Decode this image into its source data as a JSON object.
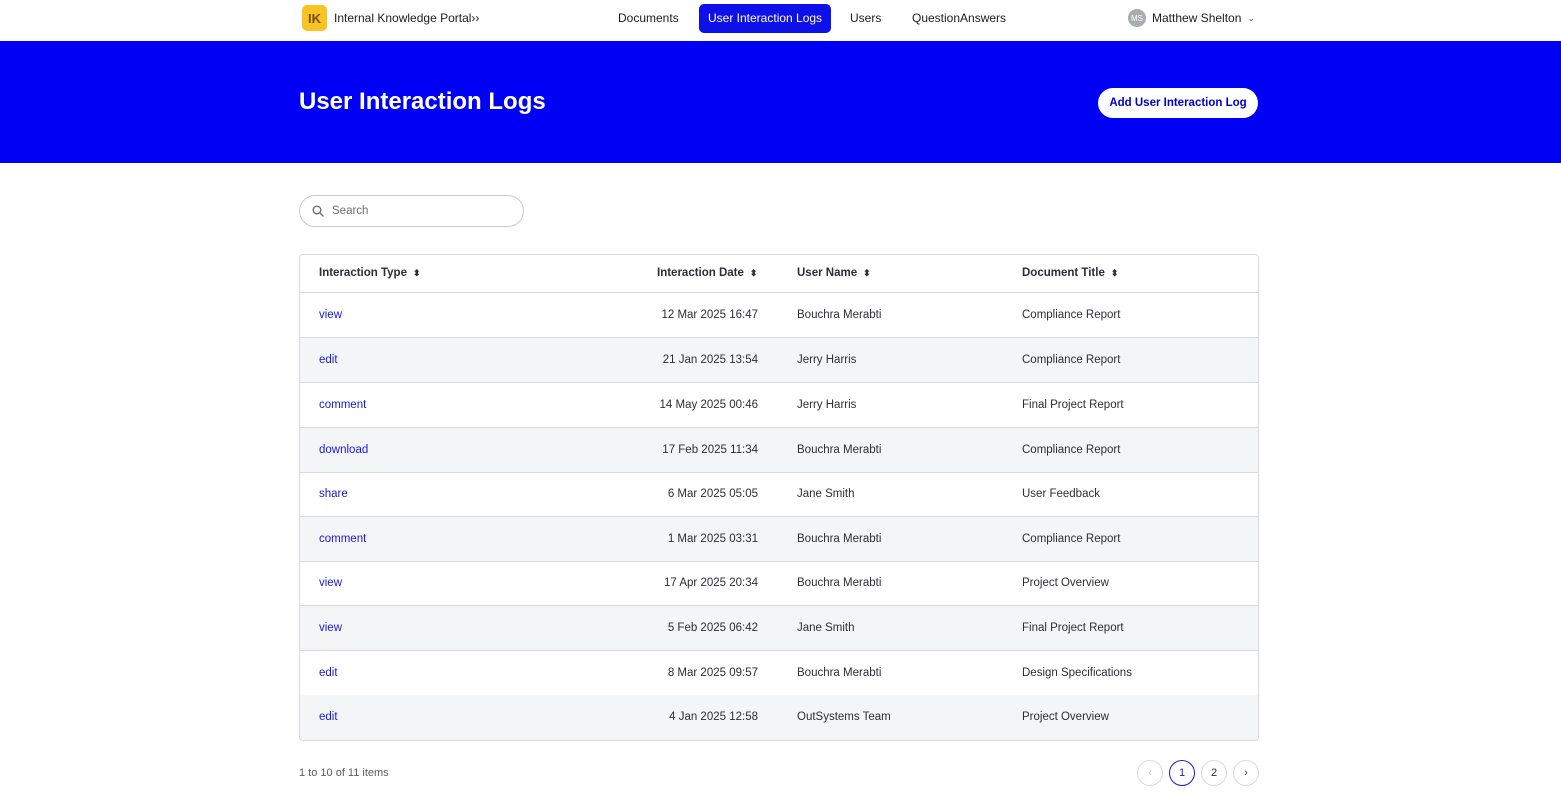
{
  "app": {
    "logo_text": "IK",
    "name": "Internal Knowledge Portal››"
  },
  "nav": [
    {
      "label": "Documents",
      "active": false
    },
    {
      "label": "User Interaction Logs",
      "active": true
    },
    {
      "label": "Users",
      "active": false
    },
    {
      "label": "QuestionAnswers",
      "active": false
    }
  ],
  "user": {
    "initials": "MS",
    "name": "Matthew Shelton"
  },
  "banner": {
    "title": "User Interaction Logs",
    "add_button": "Add User Interaction Log"
  },
  "search": {
    "placeholder": "Search",
    "value": ""
  },
  "table": {
    "columns": [
      "Interaction Type",
      "Interaction Date",
      "User Name",
      "Document Title"
    ],
    "rows": [
      {
        "type": "view",
        "date": "12 Mar 2025 16:47",
        "user": "Bouchra Merabti",
        "document": "Compliance Report"
      },
      {
        "type": "edit",
        "date": "21 Jan 2025 13:54",
        "user": "Jerry Harris",
        "document": "Compliance Report"
      },
      {
        "type": "comment",
        "date": "14 May 2025 00:46",
        "user": "Jerry Harris",
        "document": "Final Project Report"
      },
      {
        "type": "download",
        "date": "17 Feb 2025 11:34",
        "user": "Bouchra Merabti",
        "document": "Compliance Report"
      },
      {
        "type": "share",
        "date": "6 Mar 2025 05:05",
        "user": "Jane Smith",
        "document": "User Feedback"
      },
      {
        "type": "comment",
        "date": "1 Mar 2025 03:31",
        "user": "Bouchra Merabti",
        "document": "Compliance Report"
      },
      {
        "type": "view",
        "date": "17 Apr 2025 20:34",
        "user": "Bouchra Merabti",
        "document": "Project Overview"
      },
      {
        "type": "view",
        "date": "5 Feb 2025 06:42",
        "user": "Jane Smith",
        "document": "Final Project Report"
      },
      {
        "type": "edit",
        "date": "8 Mar 2025 09:57",
        "user": "Bouchra Merabti",
        "document": "Design Specifications"
      },
      {
        "type": "edit",
        "date": "4 Jan 2025 12:58",
        "user": "OutSystems Team",
        "document": "Project Overview"
      }
    ]
  },
  "pagination": {
    "summary": "1 to 10 of 11 items",
    "prev": "‹",
    "next": "›",
    "pages": [
      "1",
      "2"
    ],
    "current": "1"
  },
  "colors": {
    "accent": "#0000f4",
    "nav_active": "#0d10e8",
    "link": "#1a1ad6",
    "logo_bg": "#f7c325"
  },
  "icons": {
    "search": "search-icon",
    "sort": "sort-icon",
    "chevron": "chevron-down-icon"
  }
}
